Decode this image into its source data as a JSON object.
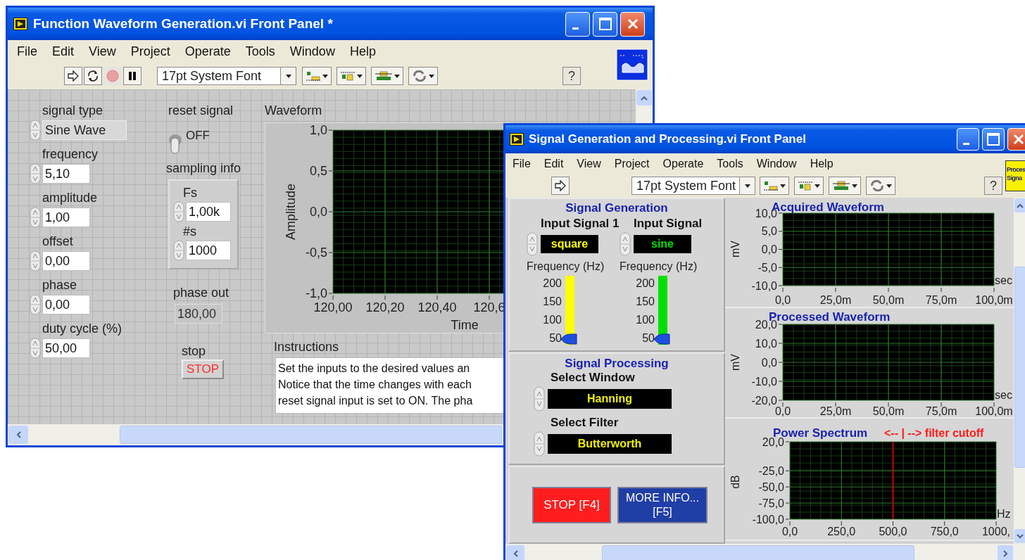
{
  "back_window": {
    "title": "Function Waveform Generation.vi Front Panel *",
    "menu": [
      "File",
      "Edit",
      "View",
      "Project",
      "Operate",
      "Tools",
      "Window",
      "Help"
    ],
    "toolbar": {
      "tools": [
        {
          "kind": "run",
          "disabled": false
        },
        {
          "kind": "run_continuously",
          "disabled": false
        },
        {
          "kind": "abort",
          "disabled": true
        },
        {
          "kind": "pause",
          "disabled": false
        }
      ],
      "font": "17pt System Font",
      "help": "?"
    },
    "controls": [
      {
        "kind": "enum",
        "label": "signal type",
        "value": "Sine Wave"
      },
      {
        "kind": "numeric",
        "label": "frequency",
        "value": "5,10"
      },
      {
        "kind": "numeric",
        "label": "amplitude",
        "value": "1,00"
      },
      {
        "kind": "numeric",
        "label": "offset",
        "value": "0,00"
      },
      {
        "kind": "numeric",
        "label": "phase",
        "value": "0,00"
      },
      {
        "kind": "numeric",
        "label": "duty cycle (%)",
        "value": "50,00"
      }
    ],
    "reset_signal": {
      "label": "reset signal",
      "on": false,
      "state_text": "OFF"
    },
    "sampling_info": {
      "label": "sampling info",
      "fields": [
        {
          "label": "Fs",
          "value": "1,00k"
        },
        {
          "label": "#s",
          "value": "1000"
        }
      ]
    },
    "phase_out": {
      "label": "phase out",
      "value": "180,00"
    },
    "stop": {
      "label": "stop",
      "button": "STOP"
    },
    "waveform": {
      "label": "Waveform",
      "chart_data": {
        "type": "line",
        "grid": true,
        "xlabel": "Time",
        "ylabel": "Amplitude",
        "xlim": [
          120,
          121
        ],
        "ylim": [
          -1,
          1
        ],
        "xticks": [
          {
            "value": 120,
            "label": "120,00"
          },
          {
            "value": 120.2,
            "label": "120,20"
          },
          {
            "value": 120.4,
            "label": "120,40"
          },
          {
            "value": 120.6,
            "label": "120,6"
          }
        ],
        "yticks": [
          {
            "value": 1,
            "label": "1,0"
          },
          {
            "value": 0.5,
            "label": "0,5"
          },
          {
            "value": 0,
            "label": "0,0"
          },
          {
            "value": -0.5,
            "label": "-0,5"
          },
          {
            "value": -1,
            "label": "-1,0"
          }
        ]
      }
    },
    "instructions": {
      "label": "Instructions",
      "lines": [
        "Set the inputs to the desired values an",
        "Notice that the time changes with each",
        "reset signal input is set to ON. The pha"
      ]
    }
  },
  "front_window": {
    "title": "Signal Generation and Processing.vi Front Panel",
    "menu": [
      "File",
      "Edit",
      "View",
      "Project",
      "Operate",
      "Tools",
      "Window",
      "Help"
    ],
    "toolbar": {
      "tools": [
        {
          "kind": "run",
          "disabled": false
        }
      ],
      "font": "17pt System Font",
      "help": "?",
      "vi_icon_text": [
        "Proces",
        "Signa"
      ]
    },
    "generation": {
      "title": "Signal Generation",
      "inputs": [
        {
          "label": "Input Signal 1",
          "value": "square",
          "color": "#ffff00",
          "frequency_label": "Frequency (Hz)",
          "ticks": [
            "200",
            "150",
            "100",
            "50"
          ],
          "level": 0
        },
        {
          "label": "Input Signal",
          "value": "sine",
          "color": "#00e000",
          "frequency_label": "Frequency (Hz)",
          "ticks": [
            "200",
            "150",
            "100",
            "50"
          ],
          "level": 0
        }
      ]
    },
    "processing": {
      "title": "Signal Processing",
      "selectors": [
        {
          "label": "Select Window",
          "value": "Hanning"
        },
        {
          "label": "Select Filter",
          "value": "Butterworth"
        }
      ]
    },
    "buttons": [
      {
        "kind": "stop",
        "label": "STOP [F4]"
      },
      {
        "kind": "info",
        "label": "MORE INFO... [F5]"
      }
    ],
    "charts": [
      {
        "chart_data": {
          "type": "line",
          "grid": true,
          "title": "Acquired Waveform",
          "xlabel": "sec",
          "ylabel": "mV",
          "xlim": [
            0,
            100
          ],
          "ylim": [
            -10,
            10
          ],
          "xticks": [
            {
              "value": 0,
              "label": "0,0"
            },
            {
              "value": 25,
              "label": "25,0m"
            },
            {
              "value": 50,
              "label": "50,0m"
            },
            {
              "value": 75,
              "label": "75,0m"
            },
            {
              "value": 100,
              "label": "100,0m"
            }
          ],
          "yticks": [
            {
              "value": 10,
              "label": "10,0"
            },
            {
              "value": 5,
              "label": "5,0"
            },
            {
              "value": 0,
              "label": "0,0"
            },
            {
              "value": -5,
              "label": "-5,0"
            },
            {
              "value": -10,
              "label": "-10,0"
            }
          ]
        }
      },
      {
        "chart_data": {
          "type": "line",
          "grid": true,
          "title": "Processed Waveform",
          "xlabel": "sec",
          "ylabel": "mV",
          "xlim": [
            0,
            100
          ],
          "ylim": [
            -20,
            20
          ],
          "xticks": [
            {
              "value": 0,
              "label": "0,0"
            },
            {
              "value": 25,
              "label": "25,0m"
            },
            {
              "value": 50,
              "label": "50,0m"
            },
            {
              "value": 75,
              "label": "75,0m"
            },
            {
              "value": 100,
              "label": "100,0m"
            }
          ],
          "yticks": [
            {
              "value": 20,
              "label": "20,0"
            },
            {
              "value": 10,
              "label": "10,0"
            },
            {
              "value": 0,
              "label": "0,0"
            },
            {
              "value": -10,
              "label": "-10,0"
            },
            {
              "value": -20,
              "label": "-20,0"
            }
          ]
        }
      },
      {
        "note": "<-- | --> filter cutoff",
        "chart_data": {
          "type": "line",
          "grid": true,
          "title": "Power Spectrum",
          "xlabel": "Hz",
          "ylabel": "dB",
          "xlim": [
            0,
            1000
          ],
          "ylim": [
            -100,
            20
          ],
          "xticks": [
            {
              "value": 0,
              "label": "0,0"
            },
            {
              "value": 250,
              "label": "250,0"
            },
            {
              "value": 500,
              "label": "500,0"
            },
            {
              "value": 750,
              "label": "750,0"
            },
            {
              "value": 1000,
              "label": "1000,"
            }
          ],
          "yticks": [
            {
              "value": 20,
              "label": "20,0"
            },
            {
              "value": -25,
              "label": "-25,0"
            },
            {
              "value": -50,
              "label": "-50,0"
            },
            {
              "value": -75,
              "label": "-75,0"
            },
            {
              "value": -100,
              "label": "-100,0"
            }
          ],
          "ref_lines": [
            {
              "axis": "x",
              "value": 500,
              "color": "#ff0000"
            }
          ]
        }
      }
    ]
  }
}
